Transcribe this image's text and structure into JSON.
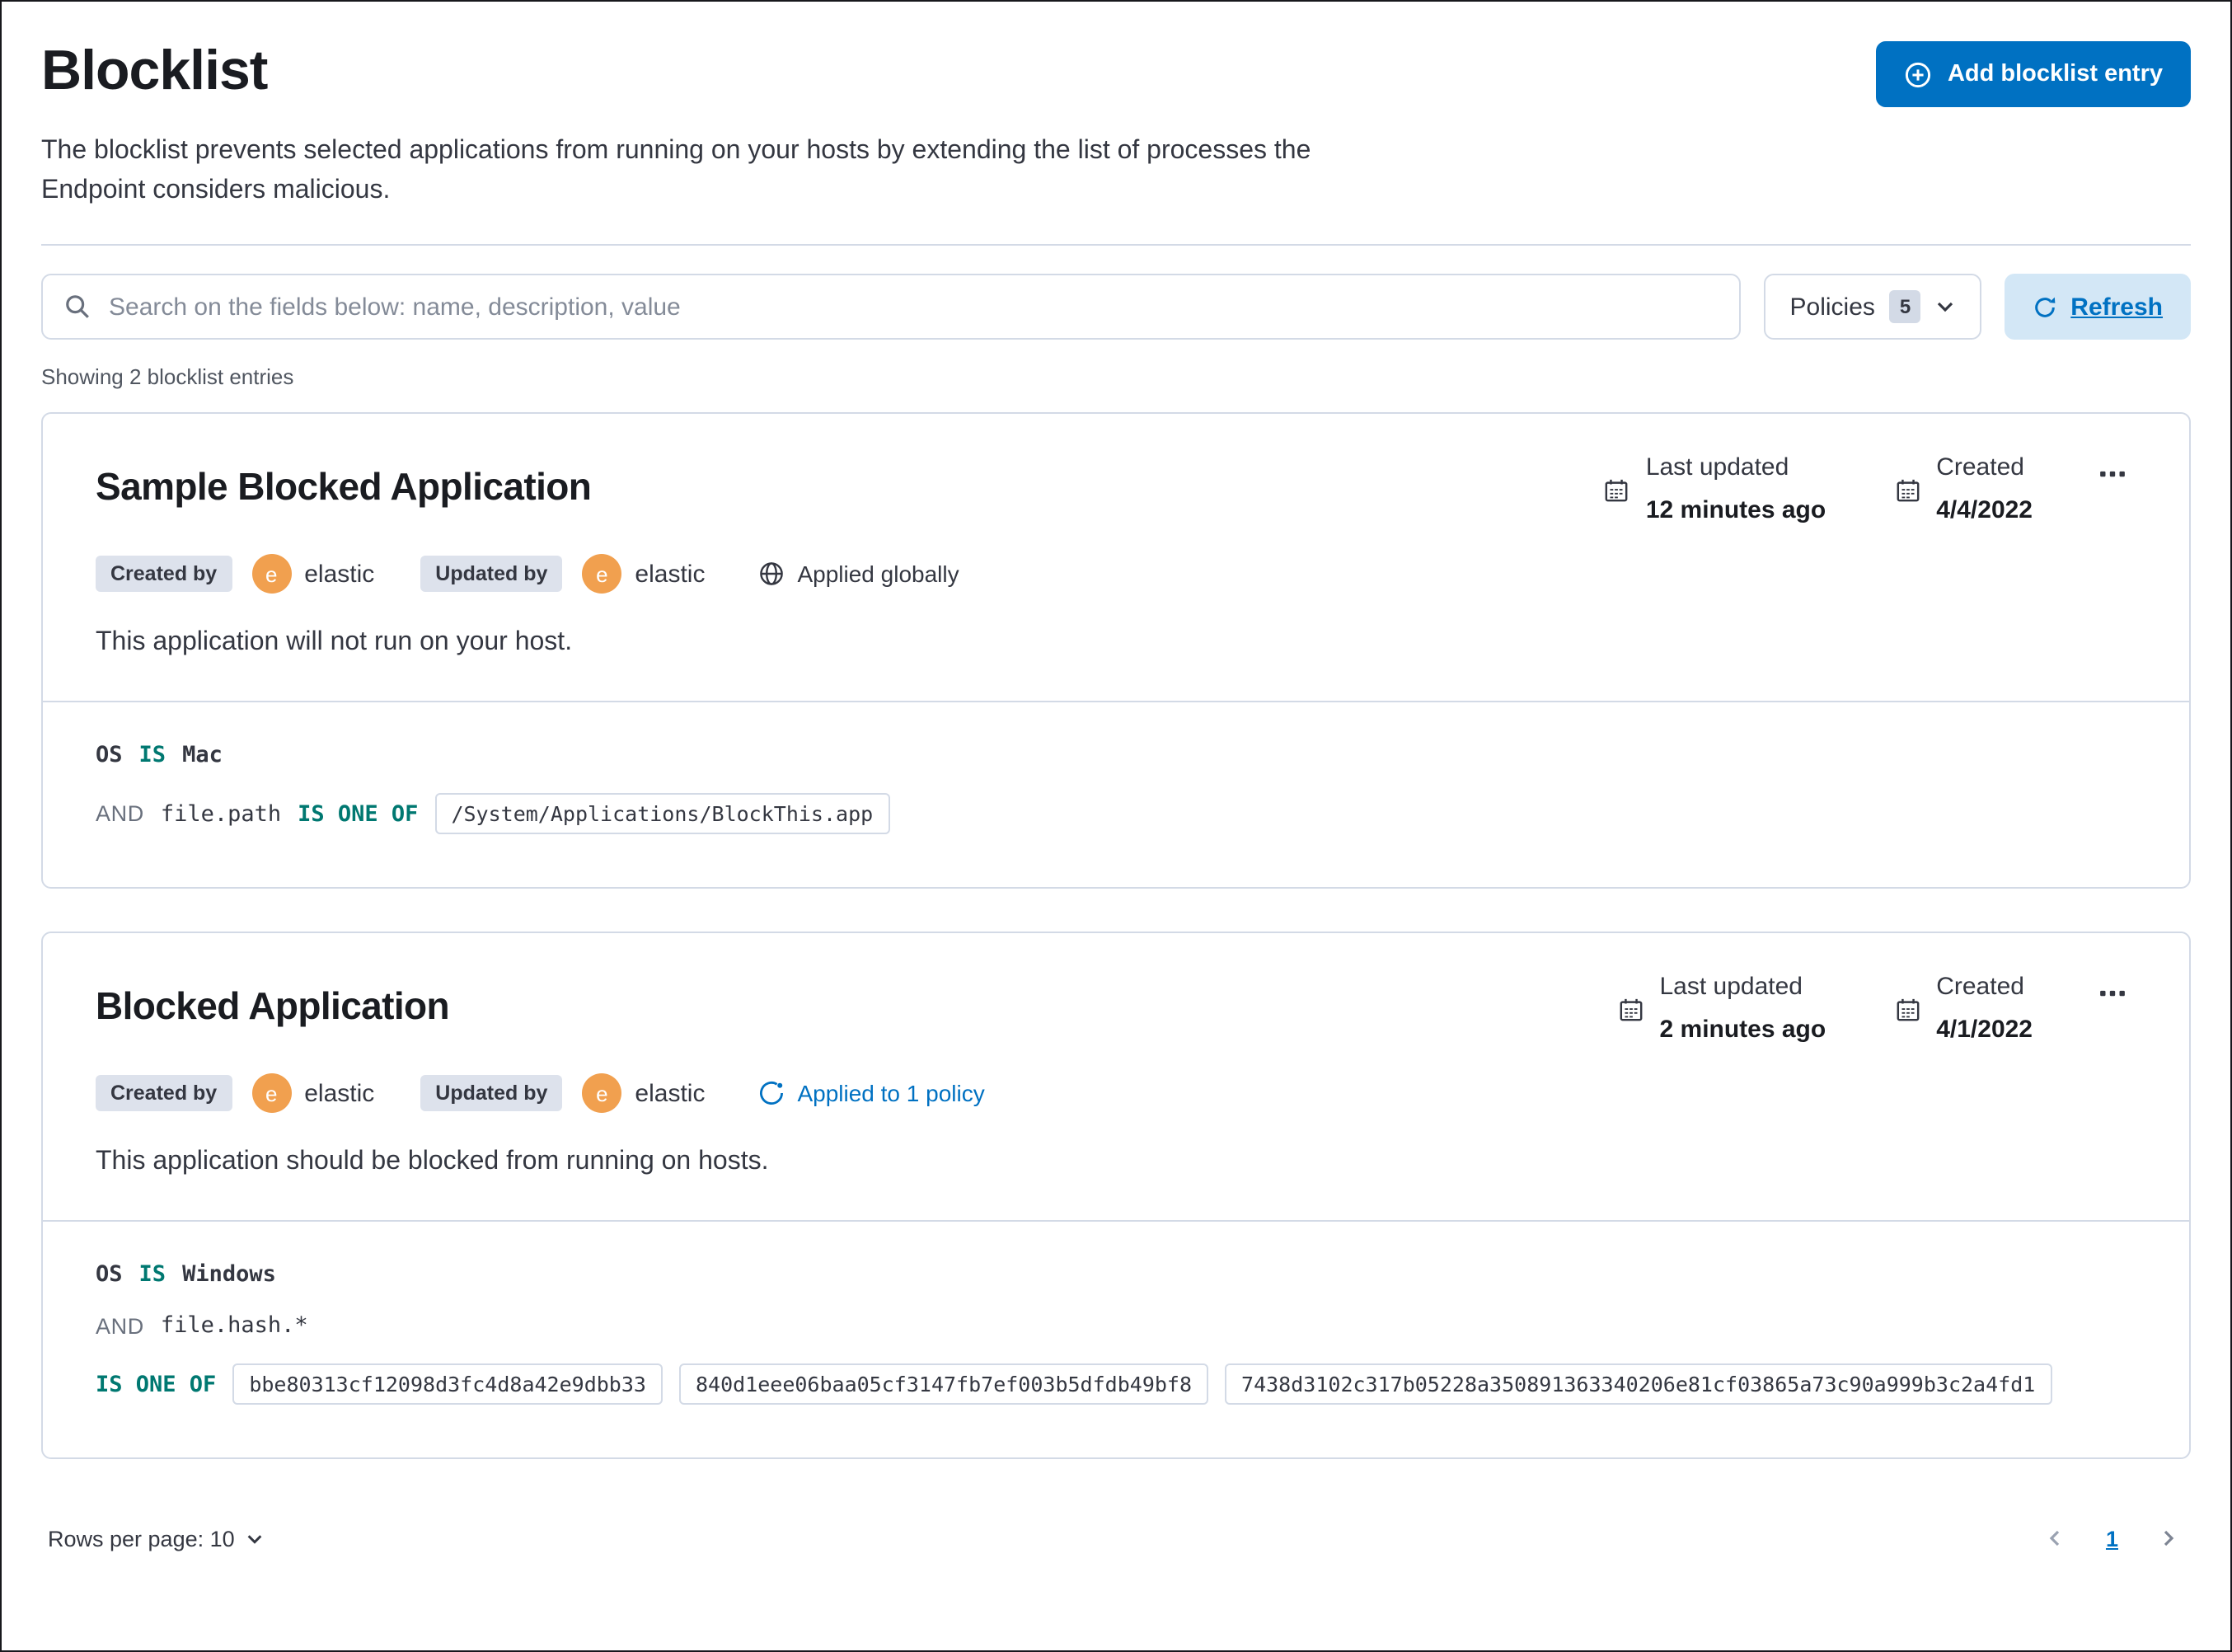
{
  "colors": {
    "primary": "#0071c2",
    "operator_teal": "#007871",
    "avatar_orange": "#f1a04f",
    "border": "#d3dae6"
  },
  "page": {
    "title": "Blocklist",
    "description": "The blocklist prevents selected applications from running on your hosts by extending the list of processes the Endpoint considers malicious.",
    "add_button_label": "Add blocklist entry",
    "search_placeholder": "Search on the fields below: name, description, value",
    "policies_label": "Policies",
    "policies_count": "5",
    "refresh_label": "Refresh",
    "showing_text": "Showing 2 blocklist entries"
  },
  "entries": [
    {
      "title": "Sample Blocked Application",
      "created_by_label": "Created by",
      "created_by_user": "elastic",
      "updated_by_label": "Updated by",
      "updated_by_user": "elastic",
      "avatar_initial": "e",
      "applied_text": "Applied globally",
      "last_updated_label": "Last updated",
      "last_updated_value": "12 minutes ago",
      "created_label": "Created",
      "created_value": "4/4/2022",
      "description": "This application will not run on your host.",
      "criteria": {
        "os_field": "OS",
        "os_operator": "IS",
        "os_value": "Mac",
        "and_label": "AND",
        "field": "file.path",
        "operator": "IS ONE OF",
        "values": [
          "/System/Applications/BlockThis.app"
        ]
      }
    },
    {
      "title": "Blocked Application",
      "created_by_label": "Created by",
      "created_by_user": "elastic",
      "updated_by_label": "Updated by",
      "updated_by_user": "elastic",
      "avatar_initial": "e",
      "applied_text": "Applied to 1 policy",
      "last_updated_label": "Last updated",
      "last_updated_value": "2 minutes ago",
      "created_label": "Created",
      "created_value": "4/1/2022",
      "description": "This application should be blocked from running on hosts.",
      "criteria": {
        "os_field": "OS",
        "os_operator": "IS",
        "os_value": "Windows",
        "and_label": "AND",
        "field": "file.hash.*",
        "operator": "IS ONE OF",
        "values": [
          "bbe80313cf12098d3fc4d8a42e9dbb33",
          "840d1eee06baa05cf3147fb7ef003b5dfdb49bf8",
          "7438d3102c317b05228a350891363340206e81cf03865a73c90a999b3c2a4fd1"
        ]
      }
    }
  ],
  "footer": {
    "rows_per_page_label": "Rows per page: 10",
    "page_number": "1"
  }
}
